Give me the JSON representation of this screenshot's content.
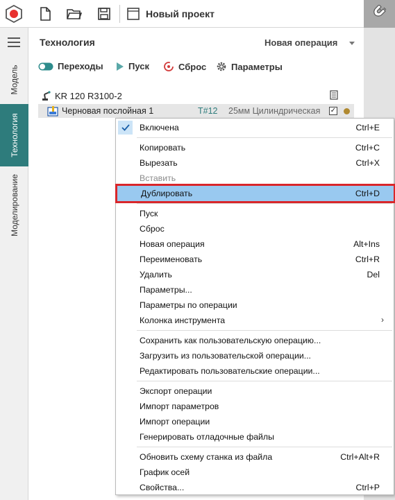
{
  "toolbar": {
    "project_name": "Новый проект",
    "icons": [
      "app-logo-icon",
      "new-file-icon",
      "open-folder-icon",
      "save-icon",
      "project-icon",
      "magnet-icon"
    ]
  },
  "sidebar": {
    "tabs": [
      {
        "label": "Модель",
        "active": false
      },
      {
        "label": "Технология",
        "active": true
      },
      {
        "label": "Моделирование",
        "active": false
      }
    ]
  },
  "panel": {
    "title": "Технология",
    "operation_select": "Новая операция",
    "actions": {
      "transitions": "Переходы",
      "run": "Пуск",
      "reset": "Сброс",
      "params": "Параметры"
    },
    "tree": {
      "robot": "KR 120 R3100-2",
      "operation": {
        "label": "Черновая послойная 1",
        "tool": "T#12",
        "description": "25мм Цилиндрическая",
        "checked": true
      }
    }
  },
  "context_menu": {
    "items": [
      {
        "label": "Включена",
        "shortcut": "Ctrl+E",
        "checked": true
      },
      {
        "label": "Копировать",
        "shortcut": "Ctrl+C"
      },
      {
        "label": "Вырезать",
        "shortcut": "Ctrl+X"
      },
      {
        "label": "Вставить",
        "shortcut": "",
        "disabled": true
      },
      {
        "label": "Дублировать",
        "shortcut": "Ctrl+D",
        "highlighted": true
      },
      {
        "label": "Пуск",
        "shortcut": ""
      },
      {
        "label": "Сброс",
        "shortcut": ""
      },
      {
        "label": "Новая операция",
        "shortcut": "Alt+Ins"
      },
      {
        "label": "Переименовать",
        "shortcut": "Ctrl+R"
      },
      {
        "label": "Удалить",
        "shortcut": "Del"
      },
      {
        "label": "Параметры...",
        "shortcut": ""
      },
      {
        "label": "Параметры по операции",
        "shortcut": ""
      },
      {
        "label": "Колонка инструмента",
        "shortcut": "",
        "submenu": true
      },
      {
        "label": "Сохранить как пользовательскую операцию...",
        "shortcut": ""
      },
      {
        "label": "Загрузить из пользовательской операции...",
        "shortcut": ""
      },
      {
        "label": "Редактировать пользовательские операции...",
        "shortcut": ""
      },
      {
        "label": "Экспорт операции",
        "shortcut": ""
      },
      {
        "label": "Импорт параметров",
        "shortcut": ""
      },
      {
        "label": "Импорт операции",
        "shortcut": ""
      },
      {
        "label": "Генерировать отладочные файлы",
        "shortcut": ""
      },
      {
        "label": "Обновить схему станка из файла",
        "shortcut": "Ctrl+Alt+R"
      },
      {
        "label": "График осей",
        "shortcut": ""
      },
      {
        "label": "Свойства...",
        "shortcut": "Ctrl+P"
      }
    ]
  }
}
